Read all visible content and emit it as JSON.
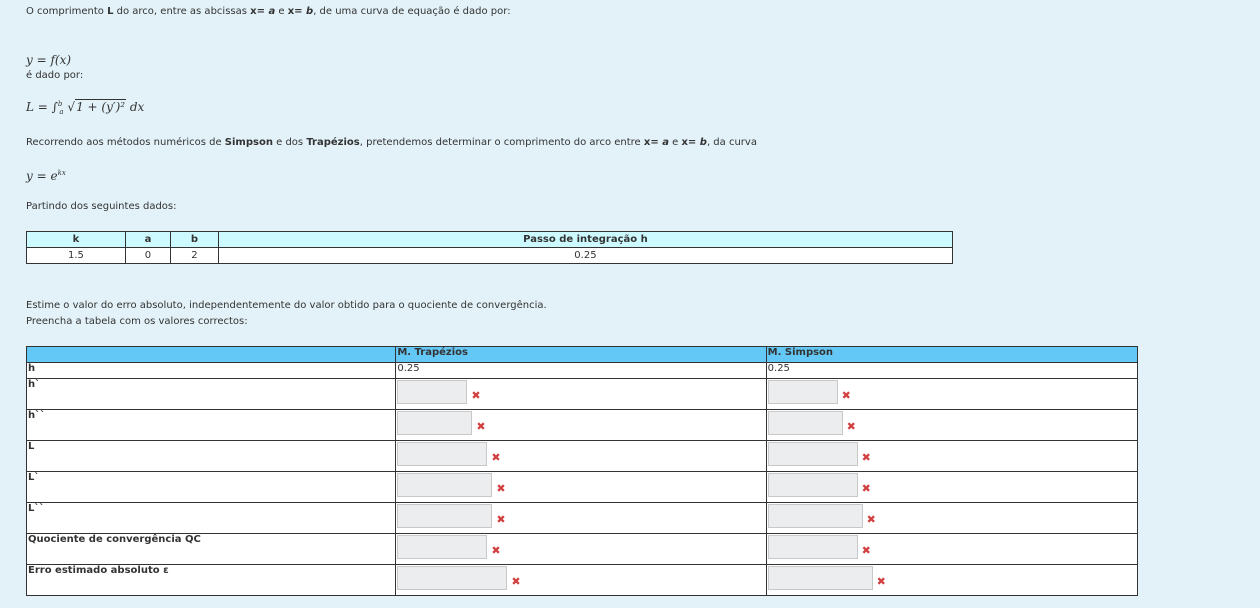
{
  "intro": {
    "text_1": "O comprimento ",
    "bold_L": "L",
    "text_2": " do arco, entre as abcissas ",
    "bold_xa": "x= ",
    "ital_a": "a",
    "text_e": " e ",
    "bold_xb": "x= ",
    "ital_b": "b",
    "text_3": ", de uma curva de equação é dado por:"
  },
  "eq_f": "y = f(x)",
  "dado_por": "é dado por:",
  "eq_L": {
    "lhs": "L = ∫",
    "upper": "b",
    "lower": "a",
    "root": "√",
    "radicand": "1 + (y′)²",
    "tail": " dx"
  },
  "methods": {
    "text_1": "Recorrendo aos métodos numéricos de ",
    "bold_simpson": "Simpson",
    "text_2": " e dos ",
    "bold_trap": "Trapézios",
    "text_3": ", pretendemos determinar o comprimento do arco entre ",
    "bold_xa": "x= ",
    "ital_a": "a",
    "text_e": " e ",
    "bold_xb": "x= ",
    "ital_b": "b",
    "text_4": ", da curva"
  },
  "eq_y": {
    "base": "y = e",
    "exp": "kx"
  },
  "partindo": "Partindo dos seguintes dados:",
  "data_table": {
    "headers": [
      "k",
      "a",
      "b",
      "Passo de integração h"
    ],
    "values": [
      "1.5",
      "0",
      "2",
      "0.25"
    ]
  },
  "estime": "Estime o valor do erro absoluto, independentemente do valor obtido para o quociente de convergência.",
  "preencha": "Preencha a tabela com os valores correctos:",
  "answer_table": {
    "col_trap": "M. Trapézios",
    "col_simp": "M. Simpson",
    "h_label": "h",
    "h_trap": "0.25",
    "h_simp": "0.25",
    "rows": [
      {
        "label": "h`",
        "w_trap": 70,
        "w_simp": 70
      },
      {
        "label": "h``",
        "w_trap": 75,
        "w_simp": 75
      },
      {
        "label": "L",
        "w_trap": 90,
        "w_simp": 90
      },
      {
        "label": "L`",
        "w_trap": 95,
        "w_simp": 90
      },
      {
        "label": "L``",
        "w_trap": 95,
        "w_simp": 95
      },
      {
        "label": "Quociente de convergência QC",
        "w_trap": 90,
        "w_simp": 90
      },
      {
        "label": "Erro estimado absoluto ε",
        "w_trap": 110,
        "w_simp": 105
      }
    ],
    "wrong_mark": "✖"
  }
}
